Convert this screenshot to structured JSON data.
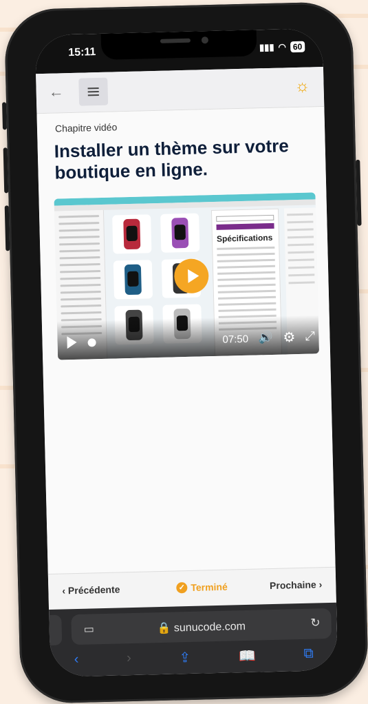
{
  "status": {
    "time": "15:11",
    "battery": "60"
  },
  "toolbar": {
    "back_icon": "←",
    "sun_icon": "☼"
  },
  "content": {
    "chapter_label": "Chapitre vidéo",
    "title": "Installer un thème sur votre boutique en ligne."
  },
  "video": {
    "spec_heading": "Spécifications",
    "duration": "07:50"
  },
  "nav": {
    "prev_label": "‹ Précédente",
    "done_label": "Terminé",
    "next_label": "Prochaine ›"
  },
  "browser": {
    "url": "🔒 sunucode.com",
    "back_icon": "‹",
    "forward_icon": "›",
    "share_icon": "⇪",
    "bookmarks_icon": "📖",
    "tabs_icon": "⧉"
  }
}
